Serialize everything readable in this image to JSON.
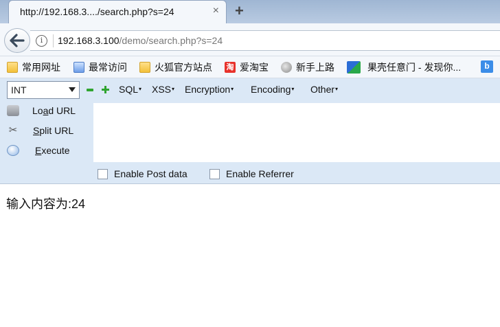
{
  "browser": {
    "tab": {
      "title": "http://192.168.3..../search.php?s=24",
      "close": "×",
      "new_tab": "+"
    },
    "url": {
      "host": "192.168.3.100",
      "path": "/demo/search.php?s=24",
      "info": "i"
    },
    "bookmarks": [
      {
        "label": "常用网址",
        "icon": "folder-icon"
      },
      {
        "label": "最常访问",
        "icon": "ie-icon"
      },
      {
        "label": "火狐官方站点",
        "icon": "folder-icon"
      },
      {
        "label": "爱淘宝",
        "icon": "taobao-icon",
        "badge": "淘"
      },
      {
        "label": "新手上路",
        "icon": "globe-icon"
      },
      {
        "label": "果壳任意门 - 发现你...",
        "icon": "guoke-icon"
      },
      {
        "label": "",
        "icon": "b-icon",
        "badge": "b"
      }
    ]
  },
  "hackbar": {
    "select_value": "INT",
    "menus": [
      "SQL",
      "XSS",
      "Encryption",
      "Encoding",
      "Other"
    ],
    "actions": [
      {
        "label_pre": "Lo",
        "label_u": "a",
        "label_post": "d URL",
        "icon": "load-url-icon"
      },
      {
        "label_pre": "",
        "label_u": "S",
        "label_post": "plit URL",
        "icon": "scissors-icon"
      },
      {
        "label_pre": "",
        "label_u": "E",
        "label_post": "xecute",
        "icon": "execute-icon"
      }
    ],
    "textarea_value": "",
    "checkboxes": [
      {
        "label": "Enable Post data",
        "checked": false
      },
      {
        "label": "Enable Referrer",
        "checked": false
      }
    ]
  },
  "page": {
    "output_text": "输入内容为:24"
  },
  "colors": {
    "toolbar_bg": "#f4f7fb",
    "hackbar_bg": "#dbe8f6",
    "minus_plus": "#2fa42f"
  }
}
